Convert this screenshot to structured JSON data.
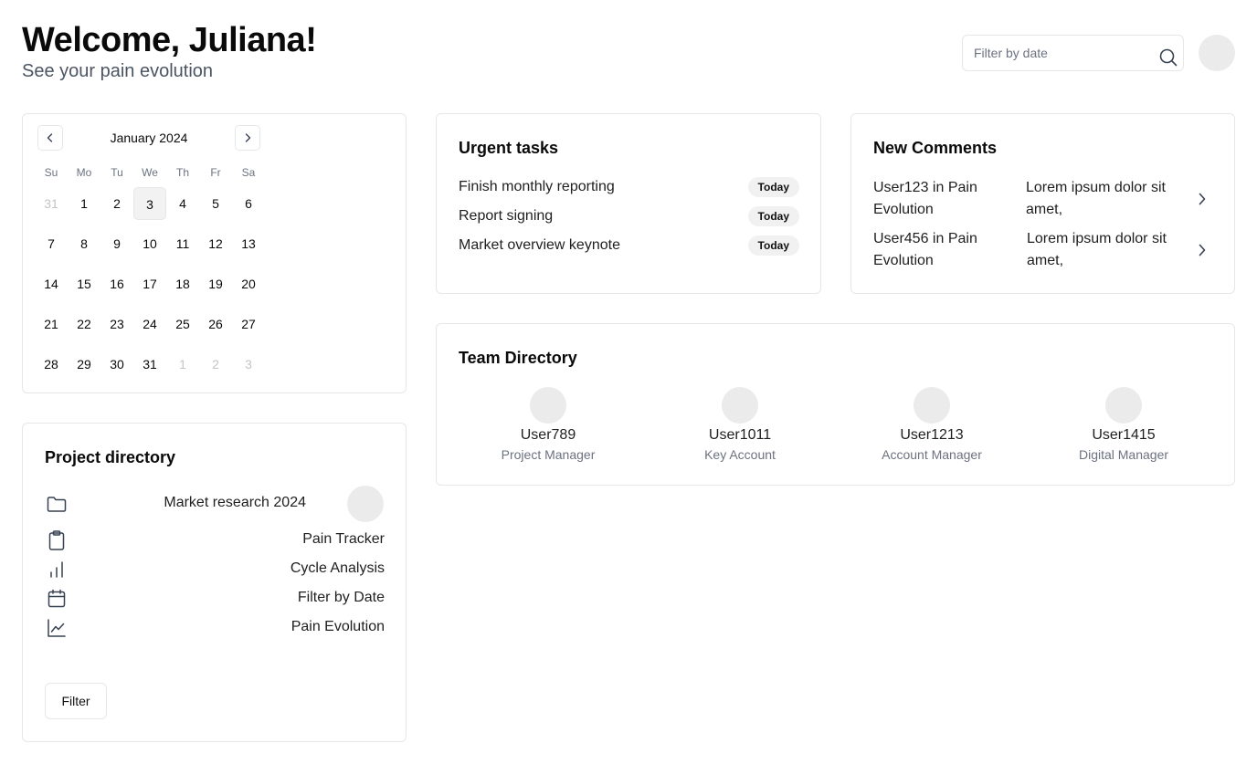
{
  "header": {
    "title": "Welcome, Juliana!",
    "subtitle": "See your pain evolution",
    "search_placeholder": "Filter by date"
  },
  "calendar": {
    "month_label": "January 2024",
    "weekdays": [
      "Su",
      "Mo",
      "Tu",
      "We",
      "Th",
      "Fr",
      "Sa"
    ],
    "weeks": [
      [
        "31",
        "1",
        "2",
        "3",
        "4",
        "5",
        "6"
      ],
      [
        "7",
        "8",
        "9",
        "10",
        "11",
        "12",
        "13"
      ],
      [
        "14",
        "15",
        "16",
        "17",
        "18",
        "19",
        "20"
      ],
      [
        "21",
        "22",
        "23",
        "24",
        "25",
        "26",
        "27"
      ],
      [
        "28",
        "29",
        "30",
        "31",
        "1",
        "2",
        "3"
      ]
    ],
    "selected_day": "3"
  },
  "project_directory": {
    "title": "Project directory",
    "items": [
      {
        "icon": "folder-icon",
        "label": "Market research 2024"
      },
      {
        "icon": "clipboard-icon",
        "label": "Pain Tracker"
      },
      {
        "icon": "bar-chart-icon",
        "label": "Cycle Analysis"
      },
      {
        "icon": "calendar-icon",
        "label": "Filter by Date"
      },
      {
        "icon": "line-chart-icon",
        "label": "Pain Evolution"
      }
    ],
    "filter_label": "Filter"
  },
  "urgent_tasks": {
    "title": "Urgent tasks",
    "items": [
      {
        "label": "Finish monthly reporting",
        "badge": "Today"
      },
      {
        "label": "Report signing",
        "badge": "Today"
      },
      {
        "label": "Market overview keynote",
        "badge": "Today"
      }
    ]
  },
  "new_comments": {
    "title": "New Comments",
    "items": [
      {
        "user": "User123 in Pain Evolution",
        "text": "Lorem ipsum dolor sit amet,"
      },
      {
        "user": "User456 in Pain Evolution",
        "text": "Lorem ipsum dolor sit amet,"
      }
    ]
  },
  "team_directory": {
    "title": "Team Directory",
    "members": [
      {
        "name": "User789",
        "role": "Project Manager"
      },
      {
        "name": "User1011",
        "role": "Key Account"
      },
      {
        "name": "User1213",
        "role": "Account Manager"
      },
      {
        "name": "User1415",
        "role": "Digital Manager"
      }
    ]
  },
  "colors": {
    "text": "#0a0a0a",
    "muted_text": "#6b7280",
    "border": "#e5e7eb",
    "badge_bg": "#f1f1f1",
    "avatar_bg": "#ebebeb"
  }
}
